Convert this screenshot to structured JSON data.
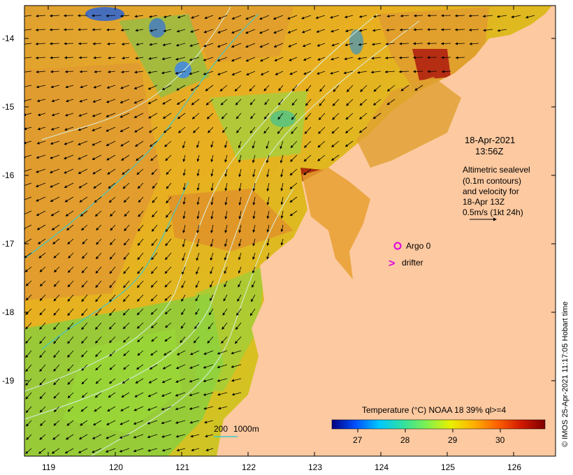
{
  "map": {
    "timestamp_date": "18-Apr-2021",
    "timestamp_time": "13:56Z",
    "legend_lines": [
      "Altimetric sealevel",
      "(0.1m contours)",
      "and velocity for",
      "18-Apr 13Z",
      "0.5m/s (1kt 24h)"
    ],
    "argo_label": "Argo 0",
    "drifter_label": "drifter",
    "drifter_symbol": ">",
    "depth_label_200": "200",
    "depth_label_1000": "1000m",
    "colorbar_title": "Temperature (°C) NOAA 18 39% ql>=4",
    "colorbar_ticks": [
      "27",
      "28",
      "29",
      "30"
    ],
    "colorbar_colors": [
      "#00007f",
      "#0050ff",
      "#00c8ff",
      "#30e0a0",
      "#80f050",
      "#e8f000",
      "#ffb000",
      "#ff6000",
      "#d01800",
      "#7f0000"
    ],
    "credit": "© IMOS 25-Apr-2021 11:17:05 Hobart time",
    "lat_labels": [
      "-14",
      "-15",
      "-16",
      "-17",
      "-18",
      "-19"
    ],
    "lon_labels": [
      "119",
      "120",
      "121",
      "122",
      "123",
      "124",
      "125",
      "126"
    ],
    "colors": {
      "land": "#fcc9a0",
      "argo": "#e000e0",
      "drifter": "#e000e0",
      "contour": "#d8efe0",
      "depth_200": "#40c8c8"
    }
  }
}
